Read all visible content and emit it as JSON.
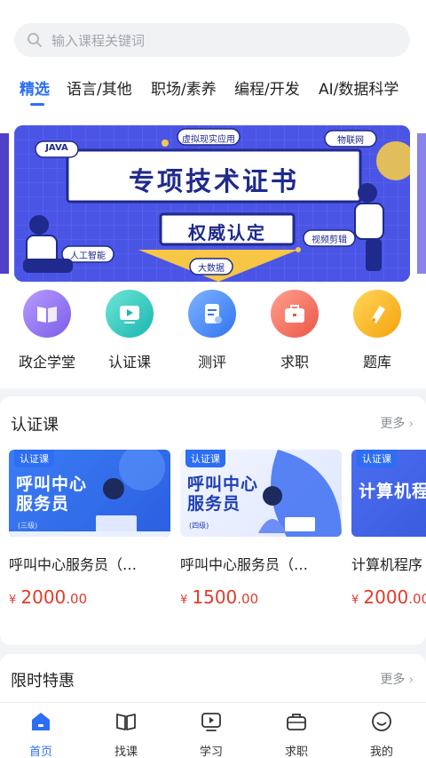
{
  "search": {
    "placeholder": "输入课程关键词"
  },
  "tabs": [
    "精选",
    "语言/其他",
    "职场/素养",
    "编程/开发",
    "AI/数据科学"
  ],
  "banner": {
    "title": "专项技术证书",
    "subtitle": "权威认定",
    "tags": [
      "JAVA",
      "虚拟现实应用",
      "物联网",
      "人工智能",
      "视频剪辑",
      "大数据"
    ]
  },
  "categories": [
    {
      "label": "政企学堂",
      "icon": "book-icon",
      "color": "#8d6cf0"
    },
    {
      "label": "认证课",
      "icon": "video-icon",
      "color": "#22c3bd"
    },
    {
      "label": "测评",
      "icon": "document-icon",
      "color": "#3f86f4"
    },
    {
      "label": "求职",
      "icon": "briefcase-icon",
      "color": "#f0695a"
    },
    {
      "label": "题库",
      "icon": "pen-icon",
      "color": "#f7b31e"
    }
  ],
  "cert_section": {
    "title": "认证课",
    "more": "更多"
  },
  "courses": [
    {
      "tag": "认证课",
      "thumb_text": "呼叫中心服务员",
      "level": "(三级)",
      "title": "呼叫中心服务员（…",
      "currency": "¥",
      "price_int": "2000",
      "price_dec": ".00"
    },
    {
      "tag": "认证课",
      "thumb_text": "呼叫中心服务员",
      "level": "(四级)",
      "title": "呼叫中心服务员（…",
      "currency": "¥",
      "price_int": "1500",
      "price_dec": ".00"
    },
    {
      "tag": "认证课",
      "thumb_text": "计算机程",
      "level": "",
      "title": "计算机程序",
      "currency": "¥",
      "price_int": "2000",
      "price_dec": ".00"
    }
  ],
  "sale_section": {
    "title": "限时特惠",
    "more": "更多"
  },
  "nav": [
    "首页",
    "找课",
    "学习",
    "求职",
    "我的"
  ],
  "colors": {
    "accent": "#2d6ef5",
    "price": "#e23b2d"
  }
}
